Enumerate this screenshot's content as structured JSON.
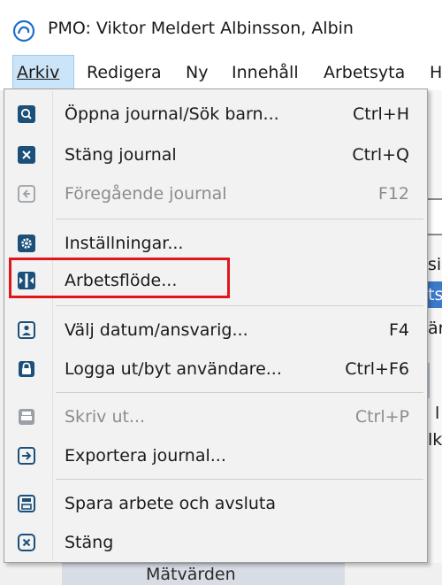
{
  "window": {
    "title": "PMO: Viktor Meldert  Albinsson, Albin",
    "accent": "#1e6fc9"
  },
  "menubar": {
    "items": [
      {
        "label": "Arkiv"
      },
      {
        "label": "Redigera"
      },
      {
        "label": "Ny"
      },
      {
        "label": "Innehåll"
      },
      {
        "label": "Arbetsyta"
      },
      {
        "label": "H"
      }
    ]
  },
  "background": {
    "fragments": [
      "sic",
      "ts",
      "är",
      "l",
      "lk"
    ],
    "bottom_label": "Mätvärden"
  },
  "dropdown": {
    "items": [
      {
        "label": "Öppna journal/Sök barn...",
        "shortcut": "Ctrl+H",
        "icon": "search-icon",
        "enabled": true
      },
      {
        "label": "Stäng journal",
        "shortcut": "Ctrl+Q",
        "icon": "close-box-icon",
        "enabled": true
      },
      {
        "label": "Föregående journal",
        "shortcut": "F12",
        "icon": "previous-icon",
        "enabled": false
      },
      {
        "label": "Inställningar...",
        "shortcut": "",
        "icon": "gear-icon",
        "enabled": true
      },
      {
        "label": "Arbetsflöde...",
        "shortcut": "",
        "icon": "workflow-icon",
        "enabled": true
      },
      {
        "label": "Välj datum/ansvarig...",
        "shortcut": "F4",
        "icon": "person-icon",
        "enabled": true
      },
      {
        "label": "Logga ut/byt användare...",
        "shortcut": "Ctrl+F6",
        "icon": "lock-icon",
        "enabled": true
      },
      {
        "label": "Skriv ut...",
        "shortcut": "Ctrl+P",
        "icon": "printer-icon",
        "enabled": false
      },
      {
        "label": "Exportera journal...",
        "shortcut": "",
        "icon": "export-icon",
        "enabled": true
      },
      {
        "label": "Spara arbete och avsluta",
        "shortcut": "",
        "icon": "save-icon",
        "enabled": true
      },
      {
        "label": "Stäng",
        "shortcut": "",
        "icon": "close-circle-icon",
        "enabled": true
      }
    ],
    "icon_color": "#1c4f7a",
    "disabled_color": "#8c8c8c",
    "highlight_color": "#e0161c"
  }
}
